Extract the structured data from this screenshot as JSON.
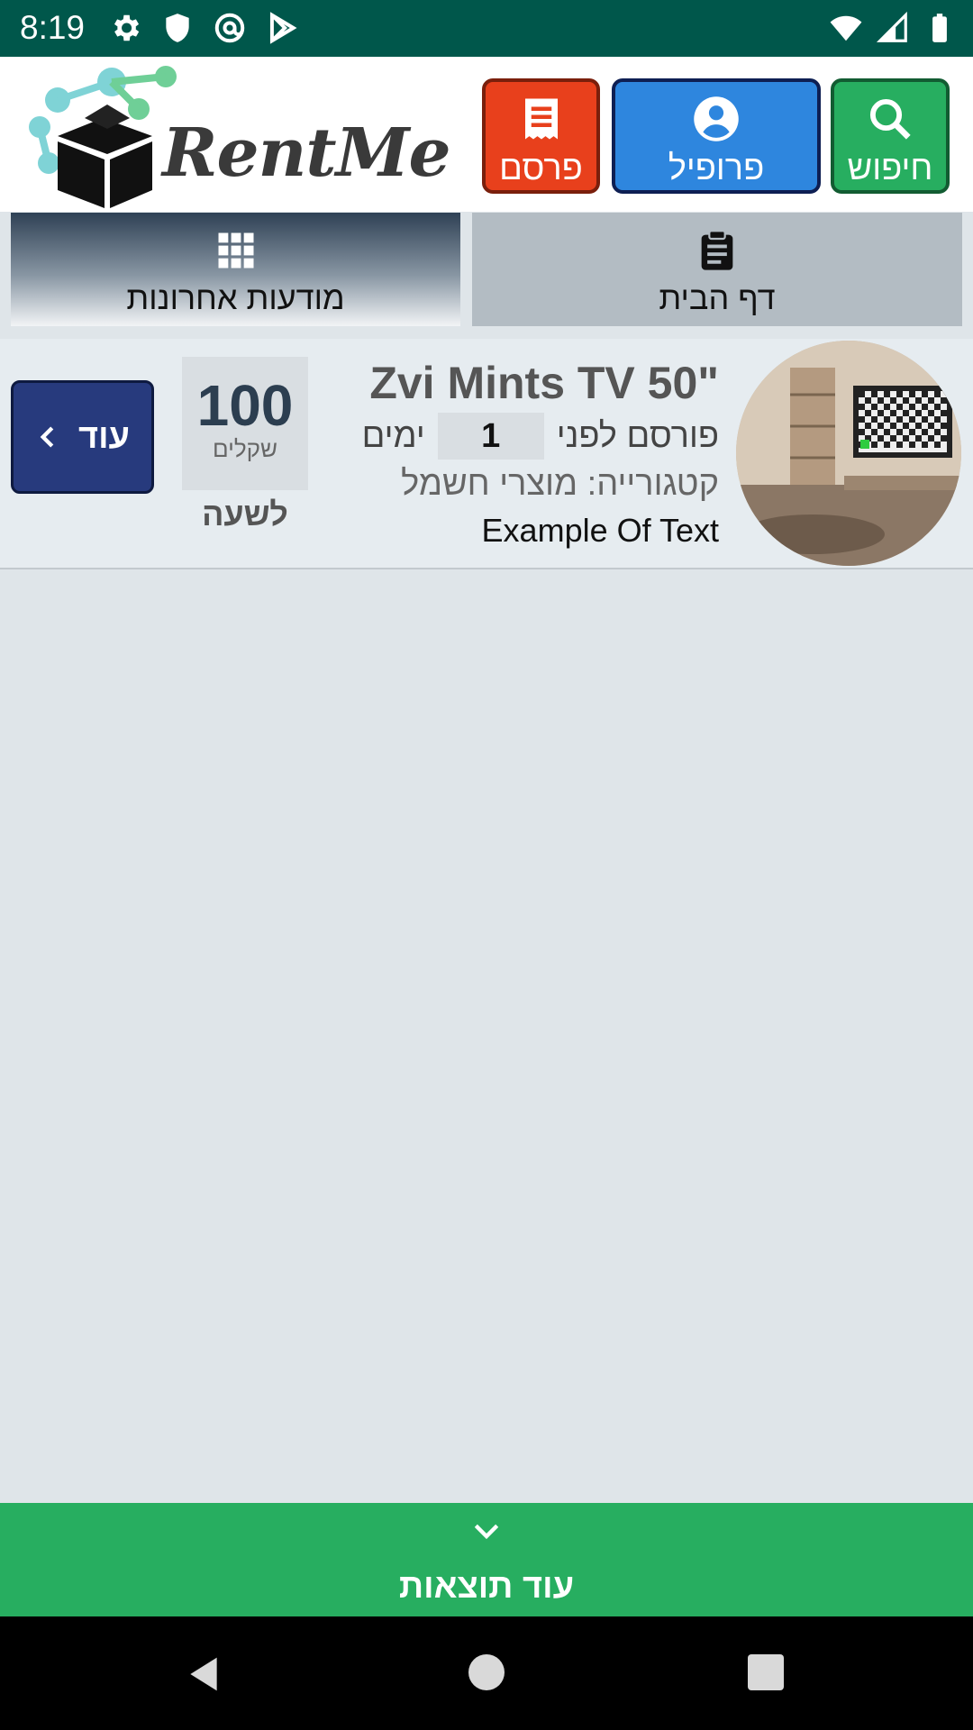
{
  "status_bar": {
    "time": "8:19",
    "icons_left": [
      "gear-icon",
      "shield-icon",
      "at-sign-icon",
      "play-store-icon"
    ],
    "icons_right": [
      "wifi-icon",
      "cell-signal-icon",
      "battery-icon"
    ]
  },
  "header": {
    "logo_text": "RentMe",
    "buttons": {
      "search": "חיפוש",
      "profile": "פרופיל",
      "publish": "פרסם"
    },
    "colors": {
      "search": "#27ae60",
      "profile": "#2e86de",
      "publish": "#e8401c"
    }
  },
  "tabs": {
    "recent": "מודעות אחרונות",
    "home": "דף הבית"
  },
  "listing": {
    "title": "Zvi Mints TV 50\"",
    "posted_prefix": "פורסם לפני",
    "days": "1",
    "posted_suffix": "ימים",
    "category_label": "קטגורייה:",
    "category_value": "מוצרי חשמל",
    "description": "Example Of Text",
    "price": "100",
    "currency": "שקלים",
    "period": "לשעה",
    "more_label": "עוד"
  },
  "footer": {
    "more_results": "עוד תוצאות"
  }
}
